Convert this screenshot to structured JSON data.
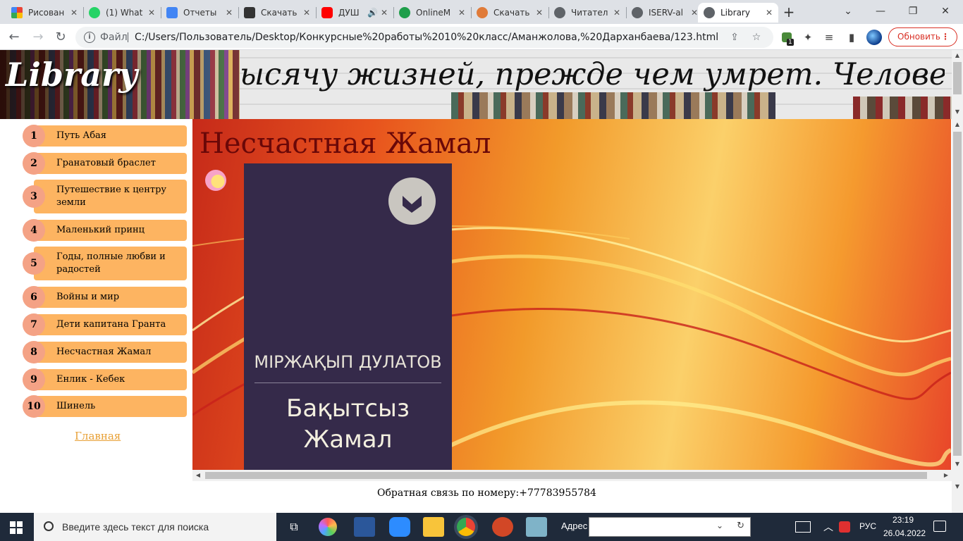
{
  "browser": {
    "tabs": [
      {
        "label": "Рисован",
        "color": "#e34234"
      },
      {
        "label": "(1) What",
        "color": "#25d366"
      },
      {
        "label": "Отчеты",
        "color": "#4285f4"
      },
      {
        "label": "Скачать",
        "color": "#333333"
      },
      {
        "label": "ДУШ",
        "color": "#ff0000"
      },
      {
        "label": "OnlineM",
        "color": "#1e9e4a"
      },
      {
        "label": "Скачать",
        "color": "#e07b39"
      },
      {
        "label": "Читател",
        "color": "#5f6368"
      },
      {
        "label": "ISERV-al",
        "color": "#5f6368"
      },
      {
        "label": "Library",
        "color": "#5f6368"
      }
    ],
    "new_tab": "+",
    "address_prefix": "Файл",
    "url": "C:/Users/Пользователь/Desktop/Конкурсные%20работы%2010%20класс/Аманжолова,%20Дарханбаева/123.html",
    "update_label": "Обновить",
    "extension_badge": "1"
  },
  "site": {
    "logo": "Library",
    "marquee": "ысячу жизней, прежде чем умрет. Человек, кото",
    "nav": [
      {
        "num": "1",
        "label": "Путь Абая"
      },
      {
        "num": "2",
        "label": "Гранатовый браслет"
      },
      {
        "num": "3",
        "label": "Путешествие к центру земли"
      },
      {
        "num": "4",
        "label": "Маленький принц"
      },
      {
        "num": "5",
        "label": "Годы, полные любви и радостей"
      },
      {
        "num": "6",
        "label": "Войны и мир"
      },
      {
        "num": "7",
        "label": "Дети капитана Гранта"
      },
      {
        "num": "8",
        "label": "Несчастная Жамал"
      },
      {
        "num": "9",
        "label": "Енлик - Кебек"
      },
      {
        "num": "10",
        "label": "Шинель"
      }
    ],
    "home_link": "Главная",
    "book_title": "Несчастная Жамал",
    "cover": {
      "author": "МІРЖАҚЫП ДУЛАТОВ",
      "title_line1": "Бақытсыз",
      "title_line2": "Жамал"
    },
    "footer": "Обратная связь по номеру:+77783955784"
  },
  "taskbar": {
    "search_placeholder": "Введите здесь текст для поиска",
    "address_label": "Адрес",
    "language": "РУС",
    "time": "23:19",
    "date": "26.04.2022"
  },
  "colors": {
    "nav_item": "#fdb461",
    "nav_number": "#f4a285",
    "title": "#6a0808",
    "cover": "#352a4a"
  }
}
